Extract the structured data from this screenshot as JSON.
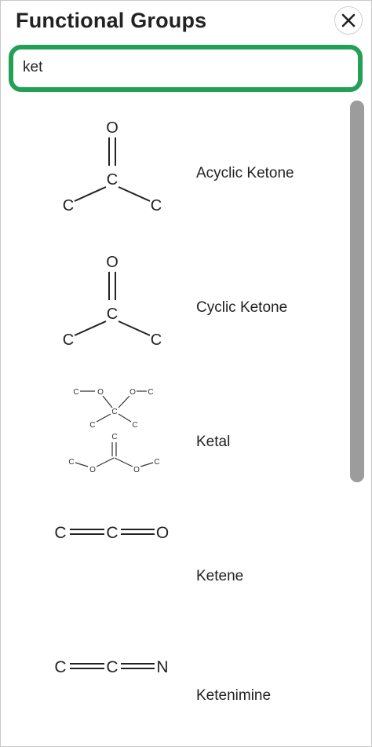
{
  "header": {
    "title": "Functional Groups",
    "close_icon": "close-icon"
  },
  "search": {
    "value": "ket"
  },
  "colors": {
    "accent": "#22a055",
    "scrollbar": "#9c9c9c",
    "text": "#222222"
  },
  "items": [
    {
      "label": "Acyclic Ketone",
      "atoms": {
        "o": "O",
        "c_center": "C",
        "c_left": "C",
        "c_right": "C"
      }
    },
    {
      "label": "Cyclic Ketone",
      "atoms": {
        "o": "O",
        "c_center": "C",
        "c_left": "C",
        "c_right": "C"
      }
    },
    {
      "label": "Ketal",
      "atoms": {
        "top_c1": "C",
        "top_o1": "O",
        "top_o2": "O",
        "top_c2": "C",
        "mid_c": "C",
        "mid_c_left": "C",
        "mid_c_right": "C",
        "bot_c_top": "C",
        "bot_c_left": "C",
        "bot_o_left": "O",
        "bot_o_right": "O",
        "bot_c_right": "C"
      }
    },
    {
      "label": "Ketene",
      "atoms": {
        "a1": "C",
        "a2": "C",
        "a3": "O"
      }
    },
    {
      "label": "Ketenimine",
      "atoms": {
        "a1": "C",
        "a2": "C",
        "a3": "N"
      }
    }
  ]
}
